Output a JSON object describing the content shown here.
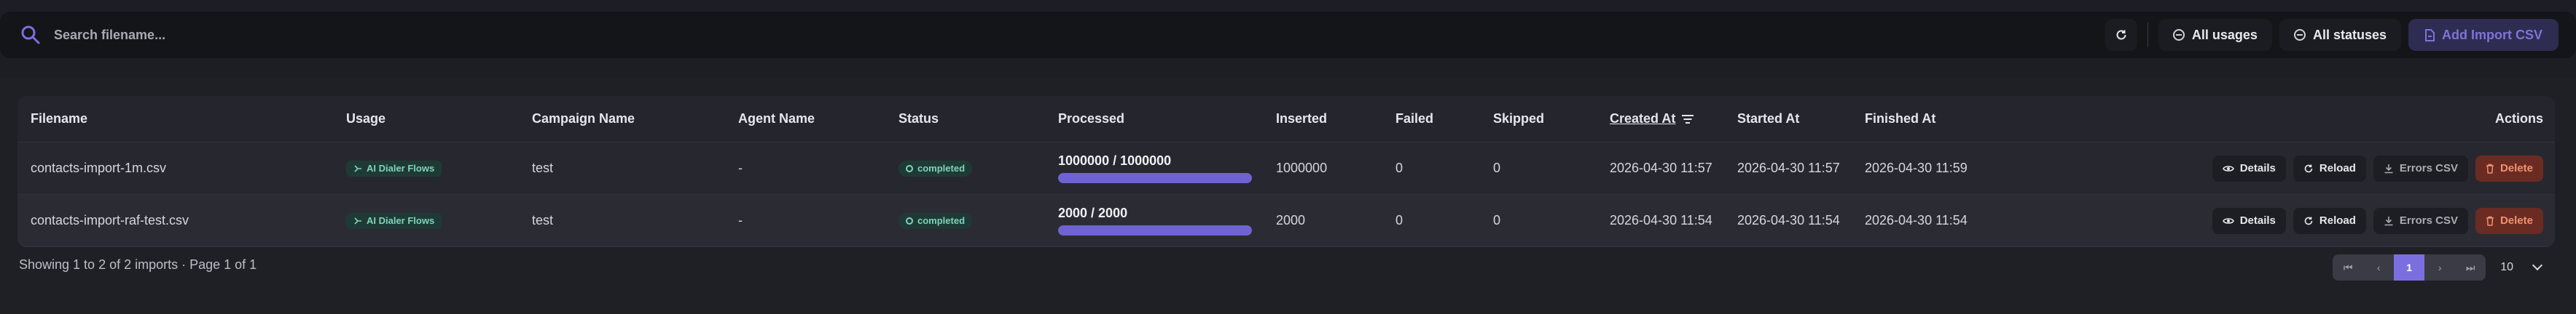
{
  "search": {
    "placeholder": "Search filename..."
  },
  "toolbar": {
    "usage_filter": "All usages",
    "status_filter": "All statuses",
    "add_label": "Add Import CSV"
  },
  "table": {
    "headers": {
      "filename": "Filename",
      "usage": "Usage",
      "campaign": "Campaign Name",
      "agent": "Agent Name",
      "status": "Status",
      "processed": "Processed",
      "inserted": "Inserted",
      "failed": "Failed",
      "skipped": "Skipped",
      "created": "Created At",
      "started": "Started At",
      "finished": "Finished At",
      "actions": "Actions"
    },
    "rows": [
      {
        "filename": "contacts-import-1m.csv",
        "usage": "AI Dialer Flows",
        "campaign": "test",
        "agent": "-",
        "status": "completed",
        "processed": "1000000 / 1000000",
        "progress_pct": 100,
        "inserted": "1000000",
        "failed": "0",
        "skipped": "0",
        "created": "2026-04-30 11:57",
        "started": "2026-04-30 11:57",
        "finished": "2026-04-30 11:59"
      },
      {
        "filename": "contacts-import-raf-test.csv",
        "usage": "AI Dialer Flows",
        "campaign": "test",
        "agent": "-",
        "status": "completed",
        "processed": "2000 / 2000",
        "progress_pct": 100,
        "inserted": "2000",
        "failed": "0",
        "skipped": "0",
        "created": "2026-04-30 11:54",
        "started": "2026-04-30 11:54",
        "finished": "2026-04-30 11:54"
      }
    ],
    "row_actions": {
      "details": "Details",
      "reload": "Reload",
      "errors": "Errors CSV",
      "delete": "Delete"
    }
  },
  "footer": {
    "summary": "Showing 1 to 2 of 2 imports · Page 1 of 1",
    "pager": {
      "current_page": "1",
      "per_page": "10"
    }
  },
  "colors": {
    "accent": "#6f63d3",
    "success": "#7fd3b8",
    "danger": "#f0926e"
  }
}
